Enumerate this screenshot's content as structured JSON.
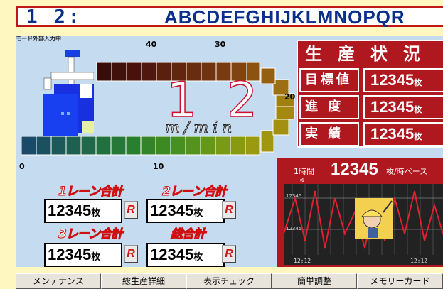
{
  "header": {
    "number": "1 2:",
    "code": "ABCDEFGHIJKLMNOPQR"
  },
  "mode_label": "モード外部入力中",
  "gauge": {
    "ticks": [
      "0",
      "10",
      "20",
      "30",
      "40"
    ],
    "speed": "1 2",
    "unit": "m/min"
  },
  "production": {
    "title": "生産状況",
    "rows": [
      {
        "label": "目標値",
        "value": "12345",
        "unit": "枚"
      },
      {
        "label": "進 度",
        "value": "12345",
        "unit": "枚"
      },
      {
        "label": "実 績",
        "value": "12345",
        "unit": "枚"
      }
    ]
  },
  "lanes": [
    {
      "label": "1レーン合計",
      "value": "12345",
      "unit": "枚",
      "reset": "R"
    },
    {
      "label": "2レーン合計",
      "value": "12345",
      "unit": "枚",
      "reset": "R"
    },
    {
      "label": "3レーン合計",
      "value": "12345",
      "unit": "枚",
      "reset": "R"
    },
    {
      "label": "総合計",
      "value": "12345",
      "unit": "枚",
      "reset": "R"
    }
  ],
  "rate": {
    "label": "1時間",
    "value": "12345",
    "unit": "枚/時ペース",
    "small": "枚",
    "y_labels": [
      "12345",
      "12345"
    ],
    "x_labels": [
      "12:12",
      "12:12"
    ]
  },
  "menu": [
    "メンテナンス",
    "総生産詳細",
    "表示チェック",
    "簡単調整",
    "メモリーカード"
  ],
  "colors": {
    "accent": "#b01820",
    "header_text": "#0a2f8a",
    "panel": "#c4dbf0"
  }
}
